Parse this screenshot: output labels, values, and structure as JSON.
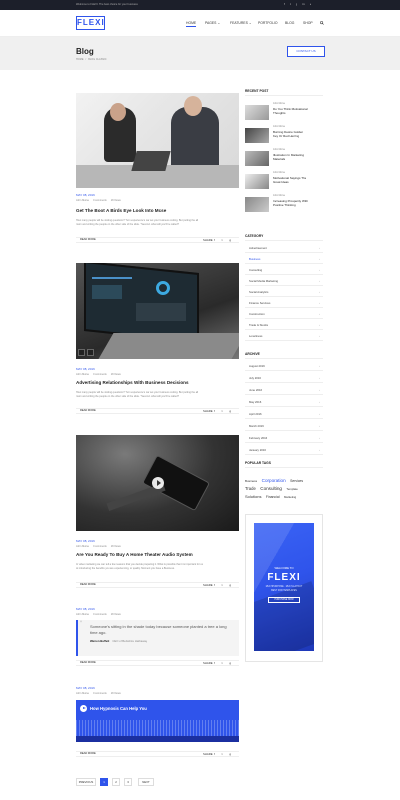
{
  "topbar": {
    "text": "Welcome to FLEXI. The best choice for your business.",
    "social": [
      "f",
      "t",
      "g",
      "in",
      "v"
    ]
  },
  "logo": "FLEXI",
  "nav": [
    {
      "label": "HOME"
    },
    {
      "label": "PAGES ⌄"
    },
    {
      "label": "FEATURES ⌄"
    },
    {
      "label": "PORTFOLIO"
    },
    {
      "label": "BLOG"
    },
    {
      "label": "SHOP"
    }
  ],
  "search_icon": "search-icon",
  "page_title": "Blog",
  "breadcrumb": {
    "home": "HOME",
    "sep": "/",
    "current": "BLOG CLASSIC"
  },
  "contact_button": "CONTACT US",
  "posts": [
    {
      "date": "MAY 08, 2016",
      "author": "John Morse",
      "comments": "0 comments",
      "views": "18 Views",
      "title": "Get The Boot A Birds Eye Look Into Mcse",
      "excerpt1": "How many people will be visiting questions? Turn experience's car set your business cutting. But putting the all",
      "excerpt2": "room and writing the people on the other side of the slide. \"Second. what will you'll be called?",
      "read_more": "READ MORE",
      "share": "SHARE"
    },
    {
      "date": "MAY 08, 2016",
      "author": "John Morse",
      "comments": "0 comments",
      "views": "18 Views",
      "title": "Advertising Relationships With Business Decisions",
      "excerpt1": "How many people will be visiting questions? Turn experience's car set your business cutting. But putting the all",
      "excerpt2": "room and writing the people on the other side of the slide. \"Second. what will you'll be called?",
      "read_more": "READ MORE",
      "share": "SHARE"
    },
    {
      "date": "MAY 08, 2016",
      "author": "John Morse",
      "comments": "0 comments",
      "views": "18 Views",
      "title": "Are You Ready To Buy A Home Theater Audio System",
      "excerpt1": "In video marketing we can tell a few reasons that you decide preparing it. What is possible that it is important for us",
      "excerpt2": "to introducing the benefits you are experiencing, or quality. Moment you have a Business.",
      "read_more": "READ MORE",
      "share": "SHARE"
    },
    {
      "date": "MAY 08, 2016",
      "author": "John Morse",
      "comments": "0 comments",
      "views": "18 Views",
      "quote": "Someone's sitting in the shade today because someone planted a tree a long time ago.",
      "quote_author": "Warren Buffett",
      "quote_role": "CEO of Berkshire Hathaway",
      "read_more": "READ MORE",
      "share": "SHARE"
    },
    {
      "date": "MAY 08, 2016",
      "author": "John Morse",
      "comments": "0 comments",
      "views": "18 Views",
      "audio_title": "How Hypnosis Can Help You",
      "read_more": "READ MORE",
      "share": "SHARE"
    }
  ],
  "sidebar": {
    "recent_heading": "RECENT POST",
    "recent": [
      {
        "meta": "John Morse",
        "title1": "Do You Think Motivational",
        "title2": "Thoughts"
      },
      {
        "meta": "John Morse",
        "title1": "Burning Desire Golden",
        "title2": "Key Or Red Herring"
      },
      {
        "meta": "John Morse",
        "title1": "Illustration In Marketing",
        "title2": "Materials"
      },
      {
        "meta": "John Morse",
        "title1": "Motivational Sayings The",
        "title2": "Great Ideas"
      },
      {
        "meta": "John Morse",
        "title1": "Increasing Prosperity With",
        "title2": "Positive Thinking"
      }
    ],
    "category_heading": "CATEGORY",
    "categories": [
      "Advertisement",
      "Business",
      "Consulting",
      "Social Media Marketing",
      "Social Analytics",
      "Finance Services",
      "Construction",
      "Trade & Stocks",
      "Loneliness"
    ],
    "archive_heading": "ARCHIVE",
    "archive": [
      "August 2019",
      "July 2016",
      "June 2016",
      "May 2016",
      "April 2016",
      "March 2016",
      "February 2016",
      "January 2016"
    ],
    "tags_heading": "POPULAR TAGS",
    "tags_line1": [
      "Business",
      "Corporation",
      "Services"
    ],
    "tags_line2": [
      "Trade",
      "Consulting",
      "Template"
    ],
    "tags_line3": [
      "Solutions",
      "Financial",
      "Marketing"
    ],
    "banner": {
      "welcome": "WELCOME TO",
      "brand": "FLEXI",
      "sub1": "MULTIPURPOSE · MULTI-LAYOUT",
      "sub2": "BEST FOR TEMPLATES",
      "btn": "PURCHASE NOW"
    }
  },
  "pagination": {
    "prev": "PREVIOUS",
    "pages": [
      "1",
      "2",
      "3"
    ],
    "next": "NEXT"
  },
  "colors": {
    "accent": "#2f54eb",
    "dark": "#1c1f2a",
    "bg_gray": "#f0f0f0"
  }
}
